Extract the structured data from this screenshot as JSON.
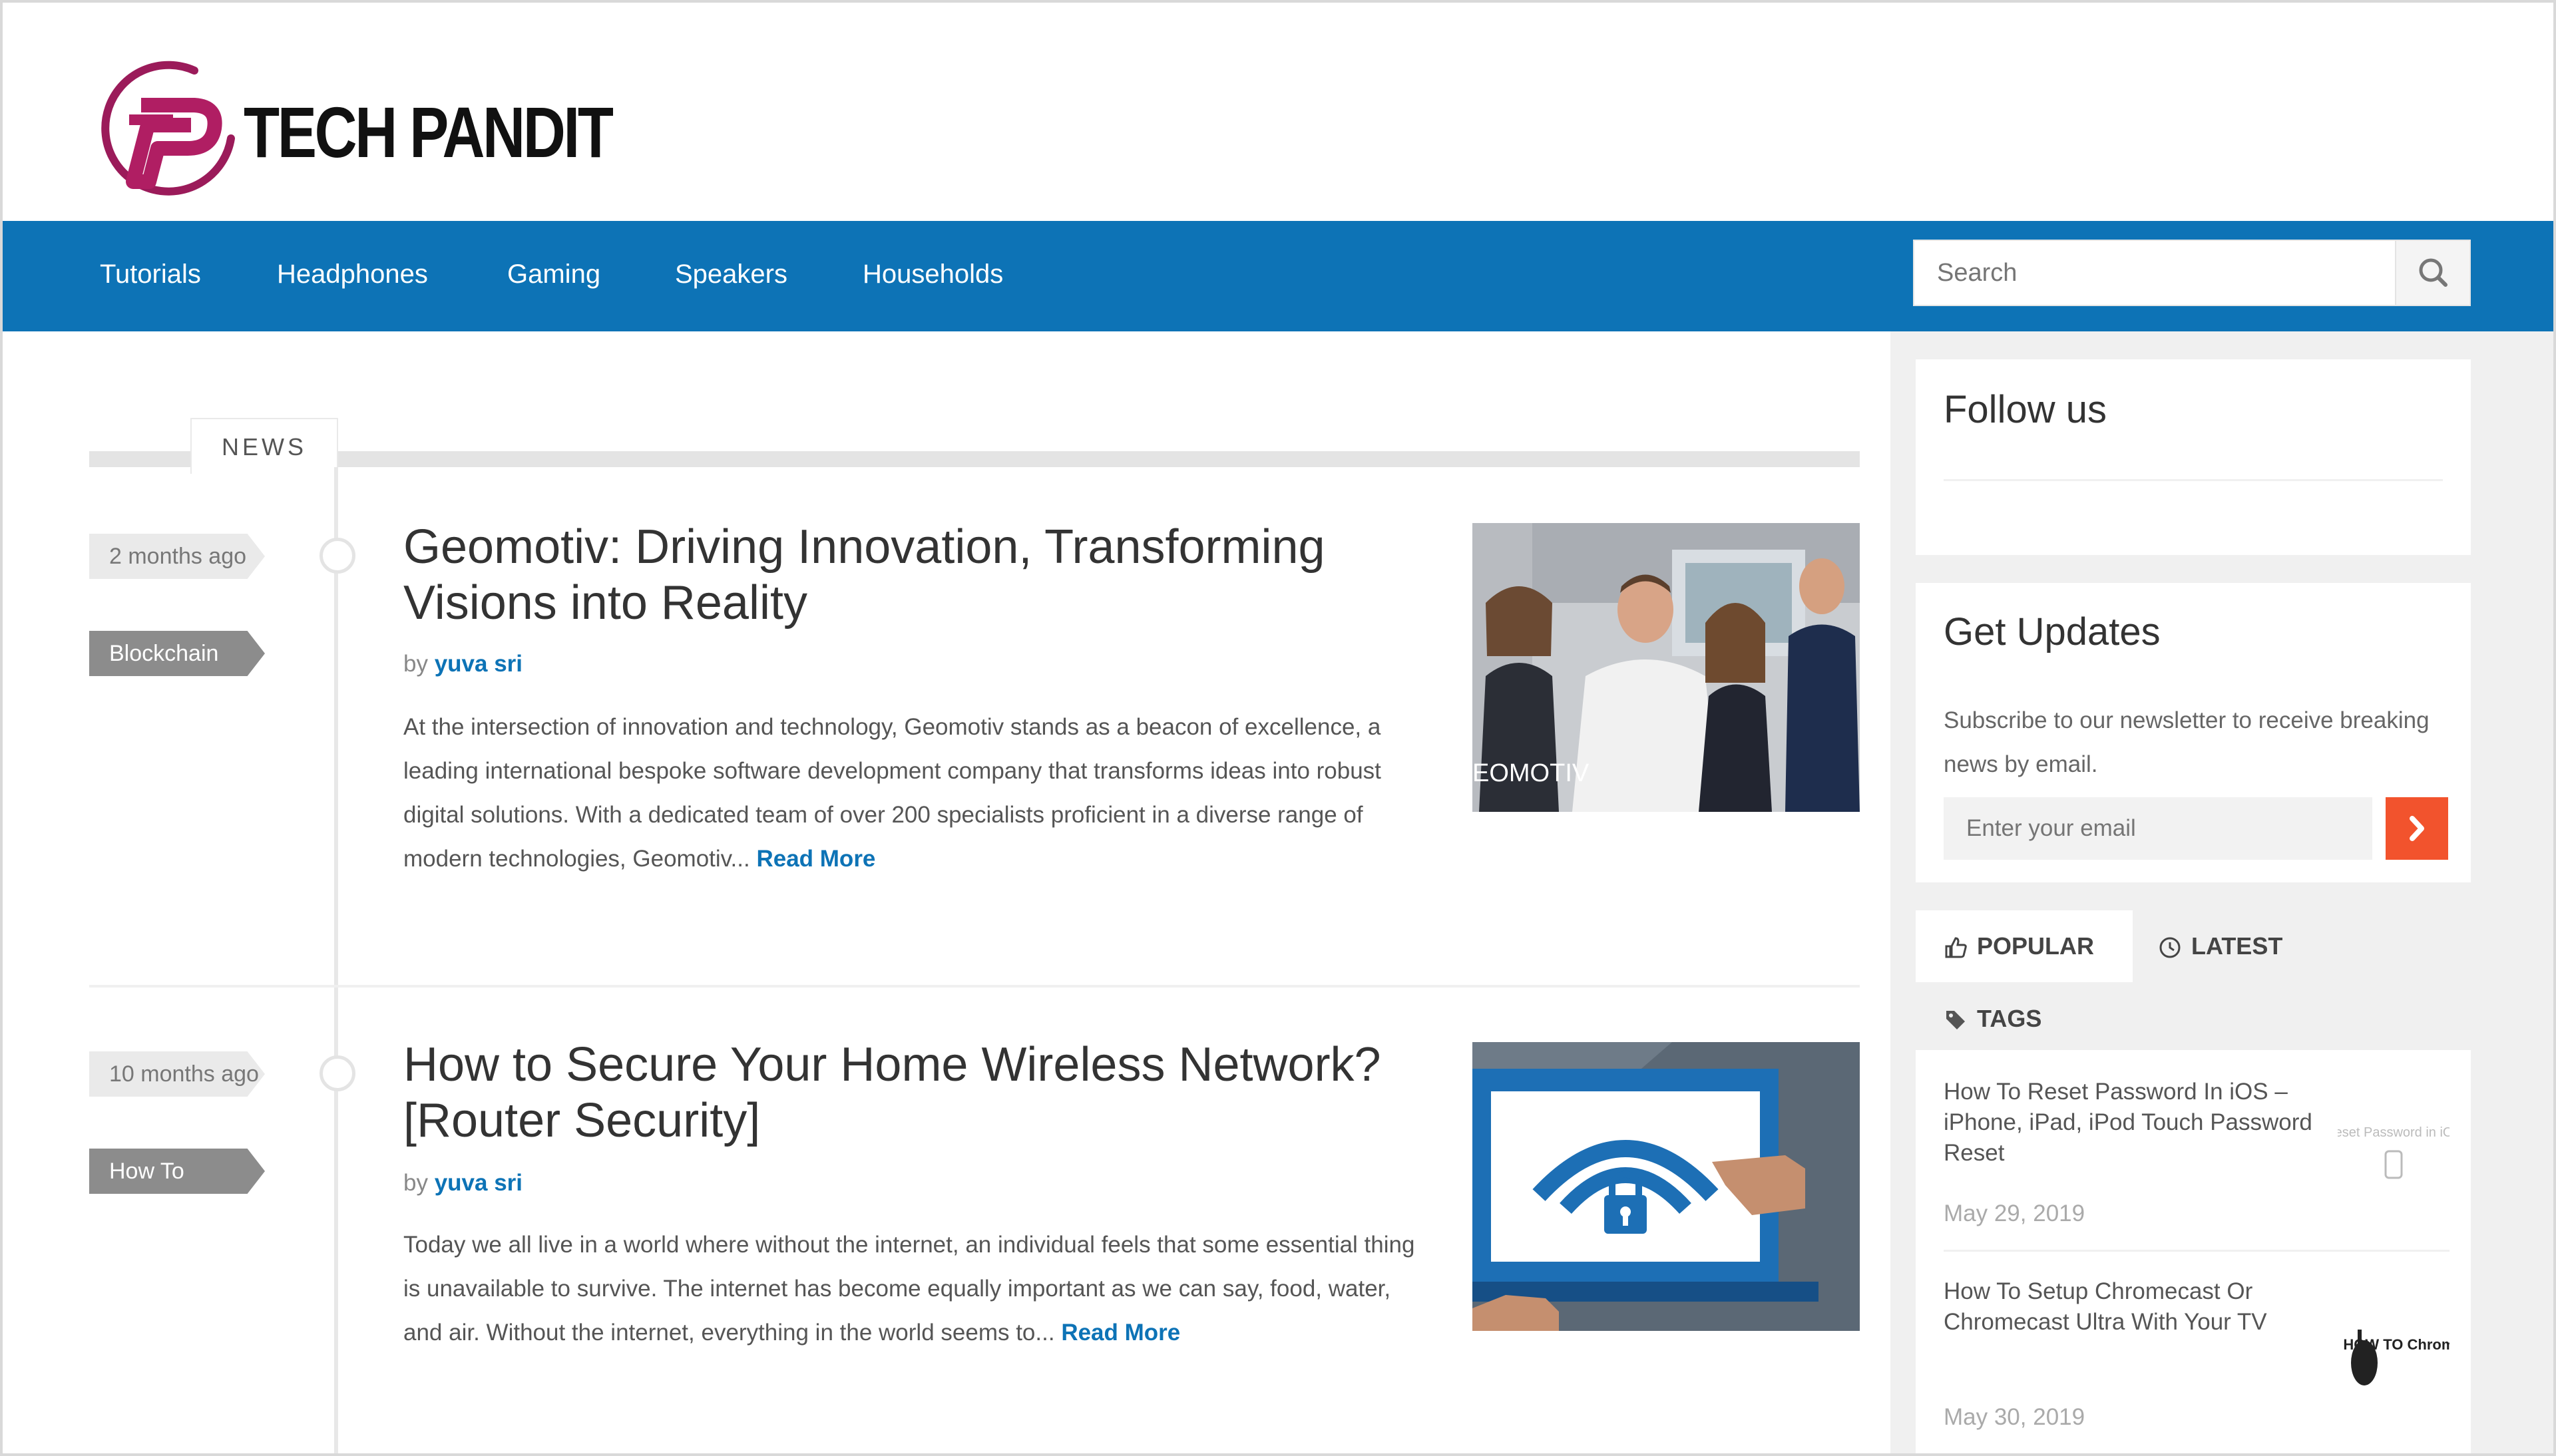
{
  "brand": {
    "name": "TECH PANDIT",
    "logo_icon": "tech-pandit-logo-icon"
  },
  "nav": {
    "items": [
      "Tutorials",
      "Headphones",
      "Gaming",
      "Speakers",
      "Households"
    ],
    "search_placeholder": "Search",
    "search_icon": "search-icon"
  },
  "section": {
    "label": "NEWS"
  },
  "posts": [
    {
      "time_ago": "2 months ago",
      "category": "Blockchain",
      "title": "Geomotiv: Driving Innovation, Transforming Visions into Reality",
      "by": "by",
      "author": "yuva sri",
      "excerpt": "At the intersection of innovation and technology, Geomotiv stands as a beacon of excellence, a leading international bespoke software development company that transforms ideas into robust digital solutions. With a dedicated team of over 200 specialists proficient in a diverse range of modern technologies, Geomotiv...",
      "read_more": "Read More",
      "image_caption": "EOMOTIV"
    },
    {
      "time_ago": "10 months ago",
      "category": "How To",
      "title": "How to Secure Your Home Wireless Network? [Router Security]",
      "by": "by",
      "author": "yuva sri",
      "excerpt": "Today we all live in a world where without the internet, an individual feels that some essential thing is unavailable to survive. The internet has become equally important as we can say, food, water, and air. Without the internet, everything in the world seems to...",
      "read_more": "Read More"
    }
  ],
  "sidebar": {
    "follow_title": "Follow us",
    "updates_title": "Get Updates",
    "updates_desc": "Subscribe to our newsletter to receive breaking news by email.",
    "email_placeholder": "Enter your email",
    "tabs": {
      "popular": "POPULAR",
      "latest": "LATEST",
      "tags": "TAGS"
    },
    "items": [
      {
        "title": "How To Reset Password In iOS – iPhone, iPad, iPod Touch Password Reset",
        "date": "May 29, 2019",
        "thumb_text": "Reset Password in iOS"
      },
      {
        "title": "How To Setup Chromecast Or Chromecast Ultra With Your TV",
        "date": "May 30, 2019",
        "thumb_text": "HOW TO Chromecast"
      }
    ]
  },
  "colors": {
    "nav_blue": "#0d73b6",
    "accent_orange": "#f2532d",
    "logo_magenta": "#9b1b5a"
  }
}
